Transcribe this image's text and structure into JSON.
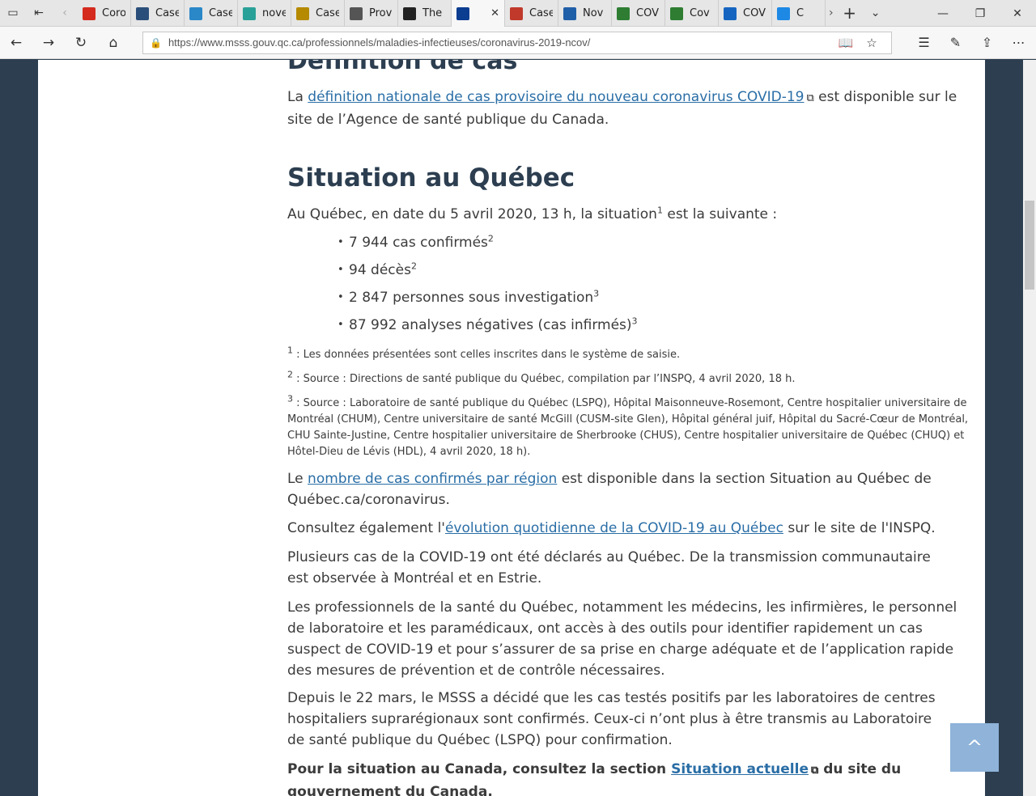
{
  "browser": {
    "tabs": [
      {
        "title": "Coro",
        "icon": "maple-leaf-icon",
        "color": "#d52b1e"
      },
      {
        "title": "Case",
        "icon": "cbc-icon",
        "color": "#2a4e7a"
      },
      {
        "title": "Case",
        "icon": "chart-icon",
        "color": "#2a87c8"
      },
      {
        "title": "nove",
        "icon": "plus-icon",
        "color": "#2aa198"
      },
      {
        "title": "Case",
        "icon": "document-icon",
        "color": "#b58900"
      },
      {
        "title": "Prov",
        "icon": "eye-icon",
        "color": "#555555"
      },
      {
        "title": "The",
        "icon": "shield-icon",
        "color": "#222222"
      },
      {
        "title": "",
        "icon": "fleur-de-lis-icon",
        "color": "#0b3d91",
        "active": true
      },
      {
        "title": "Case",
        "icon": "pen-icon",
        "color": "#c0392b"
      },
      {
        "title": "Nov",
        "icon": "who-icon",
        "color": "#1f5fa8"
      },
      {
        "title": "COV",
        "icon": "tree-icon",
        "color": "#2e7d32"
      },
      {
        "title": "Cov",
        "icon": "globe-icon",
        "color": "#2e7d32"
      },
      {
        "title": "COV",
        "icon": "circle-icon",
        "color": "#1565c0"
      },
      {
        "title": "C",
        "icon": "arc-icon",
        "color": "#1e88e5"
      }
    ],
    "url": "https://www.msss.gouv.qc.ca/professionnels/maladies-infectieuses/coronavirus-2019-ncov/"
  },
  "content": {
    "top_heading": "Définition de cas",
    "definition": {
      "before": "La ",
      "link": "définition nationale de cas provisoire du nouveau coronavirus COVID-19",
      "after": " est disponible sur le site de l’Agence de santé publique du Canada."
    },
    "situation_title": "Situation au Québec",
    "situation_intro": {
      "before": "Au Québec, en date du 5 avril 2020, 13 h, la situation",
      "sup": "1",
      "after": " est la suivante :"
    },
    "stats": [
      {
        "text": "7 944 cas confirmés",
        "sup": "2"
      },
      {
        "text": "94 décès",
        "sup": "2"
      },
      {
        "text": "2 847 personnes sous investigation",
        "sup": "3"
      },
      {
        "text": "87 992 analyses négatives (cas infirmés)",
        "sup": "3"
      }
    ],
    "footnotes": [
      {
        "num": "1",
        "text": " : Les données présentées sont celles inscrites dans le système de saisie."
      },
      {
        "num": "2",
        "text": " : Source : Directions de santé publique du Québec, compilation par l’INSPQ, 4 avril 2020, 18 h."
      },
      {
        "num": "3",
        "text": " : Source : Laboratoire de santé publique du Québec (LSPQ), Hôpital Maisonneuve-Rosemont, Centre hospitalier universitaire de Montréal (CHUM), Centre universitaire de santé McGill (CUSM-site Glen), Hôpital général juif, Hôpital du Sacré-Cœur de Montréal, CHU Sainte-Justine, Centre hospitalier universitaire de Sherbrooke (CHUS), Centre hospitalier universitaire de Québec (CHUQ) et Hôtel-Dieu de Lévis (HDL), 4 avril 2020, 18 h)."
      }
    ],
    "region_para": {
      "before": "Le ",
      "link": "nombre de cas confirmés par région",
      "after": " est disponible dans la section Situation au Québec de Québec.ca/coronavirus."
    },
    "evolution_para": {
      "before": "Consultez également l'",
      "link": "évolution quotidienne de la COVID-19 au Québec",
      "after": " sur le site de l'INSPQ."
    },
    "para_transmission": "Plusieurs cas de la COVID-19 ont été déclarés au Québec. De la transmission communautaire est observée à Montréal et en Estrie.",
    "para_professionals": "Les professionnels de la santé du Québec, notamment les médecins, les infirmières, le personnel de laboratoire et les paramédicaux, ont accès à des outils pour identifier rapidement un cas suspect de COVID-19 et pour s’assurer de sa prise en charge adéquate et de l’application rapide des mesures de prévention et de contrôle nécessaires.",
    "para_msss": "Depuis le 22 mars, le MSSS a décidé que les cas testés positifs par les laboratoires de centres hospitaliers suprarégionaux sont confirmés. Ceux-ci n’ont plus à être transmis au Laboratoire de santé publique du Québec (LSPQ) pour confirmation.",
    "canada_para": {
      "before": "Pour la situation au Canada, consultez la section ",
      "link": "Situation actuelle",
      "after": " du site du gouvernement du Canada."
    },
    "back_to_top": "^"
  }
}
